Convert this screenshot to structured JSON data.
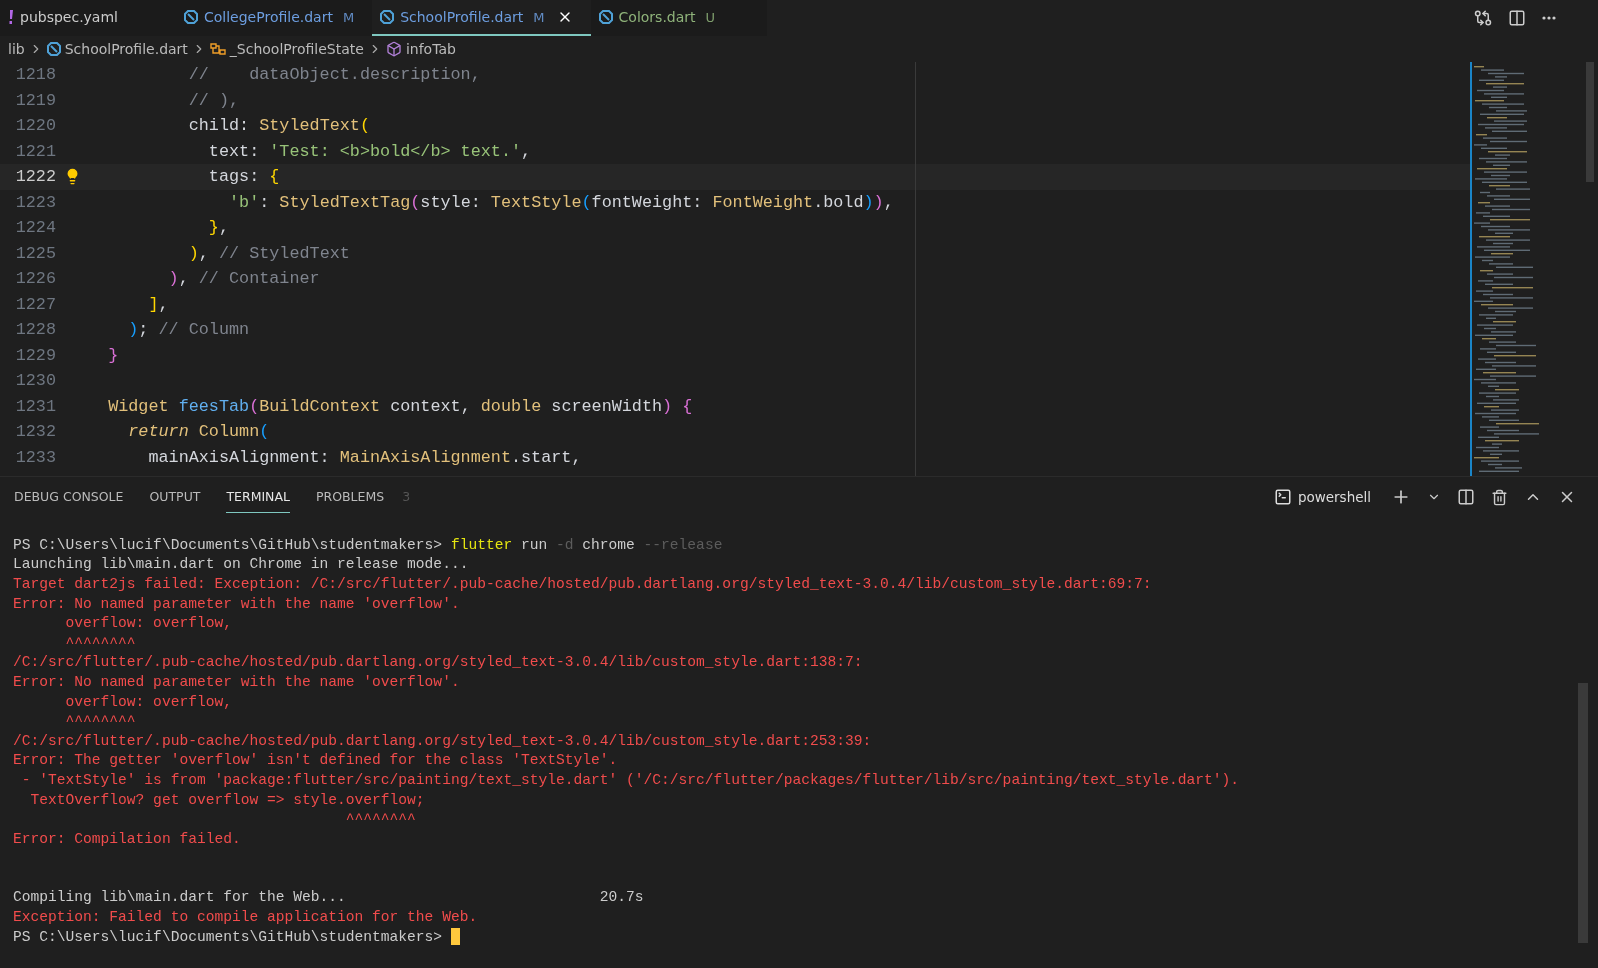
{
  "tabs": [
    {
      "label": "pubspec.yaml",
      "kind": "yaml",
      "color": "#cccccc",
      "selected": false
    },
    {
      "label": "CollegeProfile.dart",
      "kind": "dart",
      "color": "#6d9ee0",
      "status": "M",
      "selected": false
    },
    {
      "label": "SchoolProfile.dart",
      "kind": "dart",
      "color": "#6d9ee0",
      "status": "M",
      "selected": true
    },
    {
      "label": "Colors.dart",
      "kind": "dart",
      "color": "#8fb37a",
      "status": "U",
      "selected": false
    }
  ],
  "breadcrumbs": [
    {
      "label": "lib"
    },
    {
      "label": "SchoolProfile.dart",
      "kind": "dart"
    },
    {
      "label": "_SchoolProfileState",
      "kind": "class"
    },
    {
      "label": "infoTab",
      "kind": "method"
    }
  ],
  "editor": {
    "lines": [
      {
        "number": "1218",
        "current": false,
        "lightbulb": false,
        "tokens": [
          {
            "text": "          //    dataObject.description,",
            "kind": "comment"
          }
        ]
      },
      {
        "number": "1219",
        "current": false,
        "lightbulb": false,
        "tokens": [
          {
            "text": "          // ),",
            "kind": "comment"
          }
        ]
      },
      {
        "number": "1220",
        "current": false,
        "lightbulb": false,
        "tokens": [
          {
            "text": "          child: ",
            "kind": "ident"
          },
          {
            "text": "StyledText",
            "kind": "type"
          },
          {
            "text": "(",
            "kind": "b1"
          }
        ]
      },
      {
        "number": "1221",
        "current": false,
        "lightbulb": false,
        "tokens": [
          {
            "text": "            text: ",
            "kind": "ident"
          },
          {
            "text": "'Test: <b>bold</b> text.'",
            "kind": "string"
          },
          {
            "text": ",",
            "kind": "ident"
          }
        ]
      },
      {
        "number": "1222",
        "current": true,
        "lightbulb": true,
        "tokens": [
          {
            "text": "            tags: ",
            "kind": "ident"
          },
          {
            "text": "{",
            "kind": "b1"
          }
        ]
      },
      {
        "number": "1223",
        "current": false,
        "lightbulb": false,
        "tokens": [
          {
            "text": "              'b'",
            "kind": "string"
          },
          {
            "text": ": ",
            "kind": "ident"
          },
          {
            "text": "StyledTextTag",
            "kind": "type"
          },
          {
            "text": "(",
            "kind": "b2"
          },
          {
            "text": "style: ",
            "kind": "ident"
          },
          {
            "text": "TextStyle",
            "kind": "type"
          },
          {
            "text": "(",
            "kind": "b3"
          },
          {
            "text": "fontWeight: ",
            "kind": "ident"
          },
          {
            "text": "FontWeight",
            "kind": "type"
          },
          {
            "text": ".bold",
            "kind": "ident"
          },
          {
            "text": ")",
            "kind": "b3"
          },
          {
            "text": ")",
            "kind": "b2"
          },
          {
            "text": ",",
            "kind": "ident"
          }
        ]
      },
      {
        "number": "1224",
        "current": false,
        "lightbulb": false,
        "tokens": [
          {
            "text": "            }",
            "kind": "b1"
          },
          {
            "text": ",",
            "kind": "ident"
          }
        ]
      },
      {
        "number": "1225",
        "current": false,
        "lightbulb": false,
        "tokens": [
          {
            "text": "          )",
            "kind": "b1"
          },
          {
            "text": ", ",
            "kind": "ident"
          },
          {
            "text": "// StyledText",
            "kind": "comment"
          }
        ]
      },
      {
        "number": "1226",
        "current": false,
        "lightbulb": false,
        "tokens": [
          {
            "text": "        )",
            "kind": "b2"
          },
          {
            "text": ", ",
            "kind": "ident"
          },
          {
            "text": "// Container",
            "kind": "comment"
          }
        ]
      },
      {
        "number": "1227",
        "current": false,
        "lightbulb": false,
        "tokens": [
          {
            "text": "      ]",
            "kind": "b1"
          },
          {
            "text": ",",
            "kind": "ident"
          }
        ]
      },
      {
        "number": "1228",
        "current": false,
        "lightbulb": false,
        "tokens": [
          {
            "text": "    )",
            "kind": "b3"
          },
          {
            "text": "; ",
            "kind": "ident"
          },
          {
            "text": "// Column",
            "kind": "comment"
          }
        ]
      },
      {
        "number": "1229",
        "current": false,
        "lightbulb": false,
        "tokens": [
          {
            "text": "  }",
            "kind": "b2"
          }
        ]
      },
      {
        "number": "1230",
        "current": false,
        "lightbulb": false
      },
      {
        "number": "1231",
        "current": false,
        "lightbulb": false,
        "tokens": [
          {
            "text": "  Widget ",
            "kind": "type"
          },
          {
            "text": "feesTab",
            "kind": "fn"
          },
          {
            "text": "(",
            "kind": "b2"
          },
          {
            "text": "BuildContext",
            "kind": "type"
          },
          {
            "text": " context, ",
            "kind": "ident"
          },
          {
            "text": "double",
            "kind": "type"
          },
          {
            "text": " screenWidth",
            "kind": "ident"
          },
          {
            "text": ")",
            "kind": "b2"
          },
          {
            "text": " {",
            "kind": "b2"
          }
        ]
      },
      {
        "number": "1232",
        "current": false,
        "lightbulb": false,
        "tokens": [
          {
            "text": "    return ",
            "kind": "keyword"
          },
          {
            "text": "Column",
            "kind": "type"
          },
          {
            "text": "(",
            "kind": "b3"
          }
        ]
      },
      {
        "number": "1233",
        "current": false,
        "lightbulb": false,
        "tokens": [
          {
            "text": "      mainAxisAlignment: ",
            "kind": "ident"
          },
          {
            "text": "MainAxisAlignment",
            "kind": "type"
          },
          {
            "text": ".start,",
            "kind": "ident"
          }
        ]
      }
    ]
  },
  "panel": {
    "tabs": [
      {
        "label": "DEBUG CONSOLE",
        "selected": false
      },
      {
        "label": "OUTPUT",
        "selected": false
      },
      {
        "label": "TERMINAL",
        "selected": true
      },
      {
        "label": "PROBLEMS",
        "badge": "3",
        "selected": false
      }
    ],
    "shell": "powershell",
    "terminal": [
      {
        "kind": "prompt",
        "cursor": false,
        "tokens": [
          {
            "text": "PS C:\\Users\\lucif\\Documents\\GitHub\\studentmakers> ",
            "kind": "plain"
          },
          {
            "text": "flutter",
            "kind": "cmd"
          },
          {
            "text": " run ",
            "kind": "plain"
          },
          {
            "text": "-d",
            "kind": "arg"
          },
          {
            "text": " chrome ",
            "kind": "plain"
          },
          {
            "text": "--release",
            "kind": "arg"
          }
        ]
      },
      {
        "kind": "plain",
        "text": "Launching lib\\main.dart on Chrome in release mode..."
      },
      {
        "kind": "error",
        "text": "Target dart2js failed: Exception: /C:/src/flutter/.pub-cache/hosted/pub.dartlang.org/styled_text-3.0.4/lib/custom_style.dart:69:7:"
      },
      {
        "kind": "error",
        "text": "Error: No named parameter with the name 'overflow'."
      },
      {
        "kind": "error",
        "text": "      overflow: overflow,"
      },
      {
        "kind": "error",
        "text": "      ^^^^^^^^"
      },
      {
        "kind": "error",
        "text": "/C:/src/flutter/.pub-cache/hosted/pub.dartlang.org/styled_text-3.0.4/lib/custom_style.dart:138:7:"
      },
      {
        "kind": "error",
        "text": "Error: No named parameter with the name 'overflow'."
      },
      {
        "kind": "error",
        "text": "      overflow: overflow,"
      },
      {
        "kind": "error",
        "text": "      ^^^^^^^^"
      },
      {
        "kind": "error",
        "text": "/C:/src/flutter/.pub-cache/hosted/pub.dartlang.org/styled_text-3.0.4/lib/custom_style.dart:253:39:"
      },
      {
        "kind": "error",
        "text": "Error: The getter 'overflow' isn't defined for the class 'TextStyle'."
      },
      {
        "kind": "error",
        "text": " - 'TextStyle' is from 'package:flutter/src/painting/text_style.dart' ('/C:/src/flutter/packages/flutter/lib/src/painting/text_style.dart')."
      },
      {
        "kind": "error",
        "text": "  TextOverflow? get overflow => style.overflow;"
      },
      {
        "kind": "error",
        "text": "                                      ^^^^^^^^"
      },
      {
        "kind": "error",
        "text": "Error: Compilation failed."
      },
      {
        "kind": "blank"
      },
      {
        "kind": "blank"
      },
      {
        "kind": "plain",
        "text": "Compiling lib\\main.dart for the Web...                             20.7s"
      },
      {
        "kind": "error",
        "text": "Exception: Failed to compile application for the Web."
      },
      {
        "kind": "prompt",
        "cursor": true,
        "tokens": [
          {
            "text": "PS C:\\Users\\lucif\\Documents\\GitHub\\studentmakers> ",
            "kind": "plain"
          }
        ]
      }
    ]
  }
}
